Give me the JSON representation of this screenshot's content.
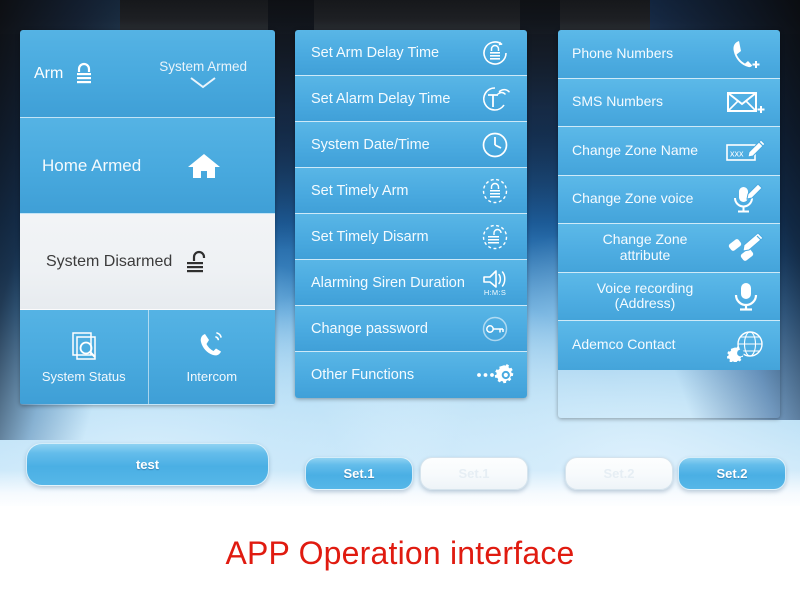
{
  "caption": {
    "text": "APP Operation interface",
    "color": "#e01b10"
  },
  "theme": {
    "panel_blue": "#4aaae0",
    "panel_white": "#eef1f4",
    "button_blue": "#56b7e8",
    "text_white": "#f5fbff"
  },
  "left_panel": {
    "arm_row": {
      "label": "Arm",
      "icon": "padlock-closed-icon",
      "state_label": "System Armed",
      "state_icon": "chevron-down-icon"
    },
    "home_row": {
      "label": "Home Armed",
      "icon": "house-icon"
    },
    "disarmed_row": {
      "label": "System Disarmed",
      "icon": "padlock-open-icon"
    },
    "bottom_tiles": [
      {
        "label": "System Status",
        "icon": "document-magnifier-icon"
      },
      {
        "label": "Intercom",
        "icon": "telephone-handset-icon"
      }
    ]
  },
  "middle_panel": {
    "items": [
      {
        "label": "Set Arm Delay Time",
        "icon": "lock-clock-icon"
      },
      {
        "label": "Set Alarm Delay Time",
        "icon": "siren-signal-icon"
      },
      {
        "label": "System Date/Time",
        "icon": "clock-icon"
      },
      {
        "label": "Set Timely Arm",
        "icon": "lock-dial-icon"
      },
      {
        "label": "Set Timely Disarm",
        "icon": "unlock-dial-icon"
      },
      {
        "label": "Alarming Siren Duration",
        "icon": "speaker-sound-icon",
        "sub": "H:M:S"
      },
      {
        "label": "Change password",
        "icon": "key-circle-icon"
      },
      {
        "label": "Other Functions",
        "icon": "gear-dots-icon"
      }
    ]
  },
  "right_panel": {
    "items": [
      {
        "label": "Phone Numbers",
        "icon": "phone-plus-icon"
      },
      {
        "label": "SMS Numbers",
        "icon": "envelope-plus-icon"
      },
      {
        "label": "Change Zone Name",
        "icon": "textbox-pencil-icon",
        "badge": "xxx"
      },
      {
        "label": "Change Zone voice",
        "icon": "microphone-pencil-icon"
      },
      {
        "label": "Change Zone attribute",
        "icon": "tags-pencil-icon",
        "lines": [
          "Change Zone",
          "attribute"
        ]
      },
      {
        "label": "Voice recording (Address)",
        "icon": "microphone-icon",
        "lines": [
          "Voice recording",
          "(Address)"
        ]
      },
      {
        "label": "Ademco Contact",
        "icon": "globe-gear-icon"
      }
    ]
  },
  "buttons": {
    "test": "test",
    "set1": "Set.1",
    "set1_inactive": "Set.1",
    "set2_inactive": "Set.2",
    "set2": "Set.2"
  }
}
